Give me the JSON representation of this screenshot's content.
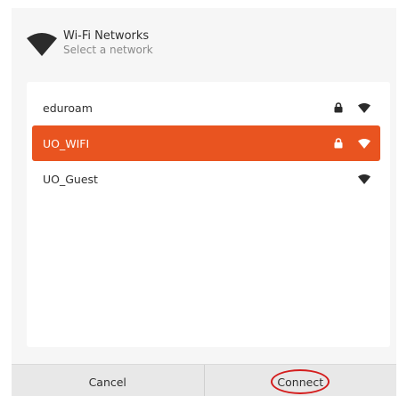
{
  "header": {
    "title": "Wi-Fi Networks",
    "subtitle": "Select a network",
    "icon": "wifi-signal-icon"
  },
  "networks": [
    {
      "name": "eduroam",
      "secured": true,
      "selected": false
    },
    {
      "name": "UO_WIFI",
      "secured": true,
      "selected": true
    },
    {
      "name": "UO_Guest",
      "secured": false,
      "selected": false
    }
  ],
  "footer": {
    "cancel_label": "Cancel",
    "connect_label": "Connect"
  },
  "colors": {
    "accent": "#e95420",
    "annotation": "#d41d1d"
  }
}
